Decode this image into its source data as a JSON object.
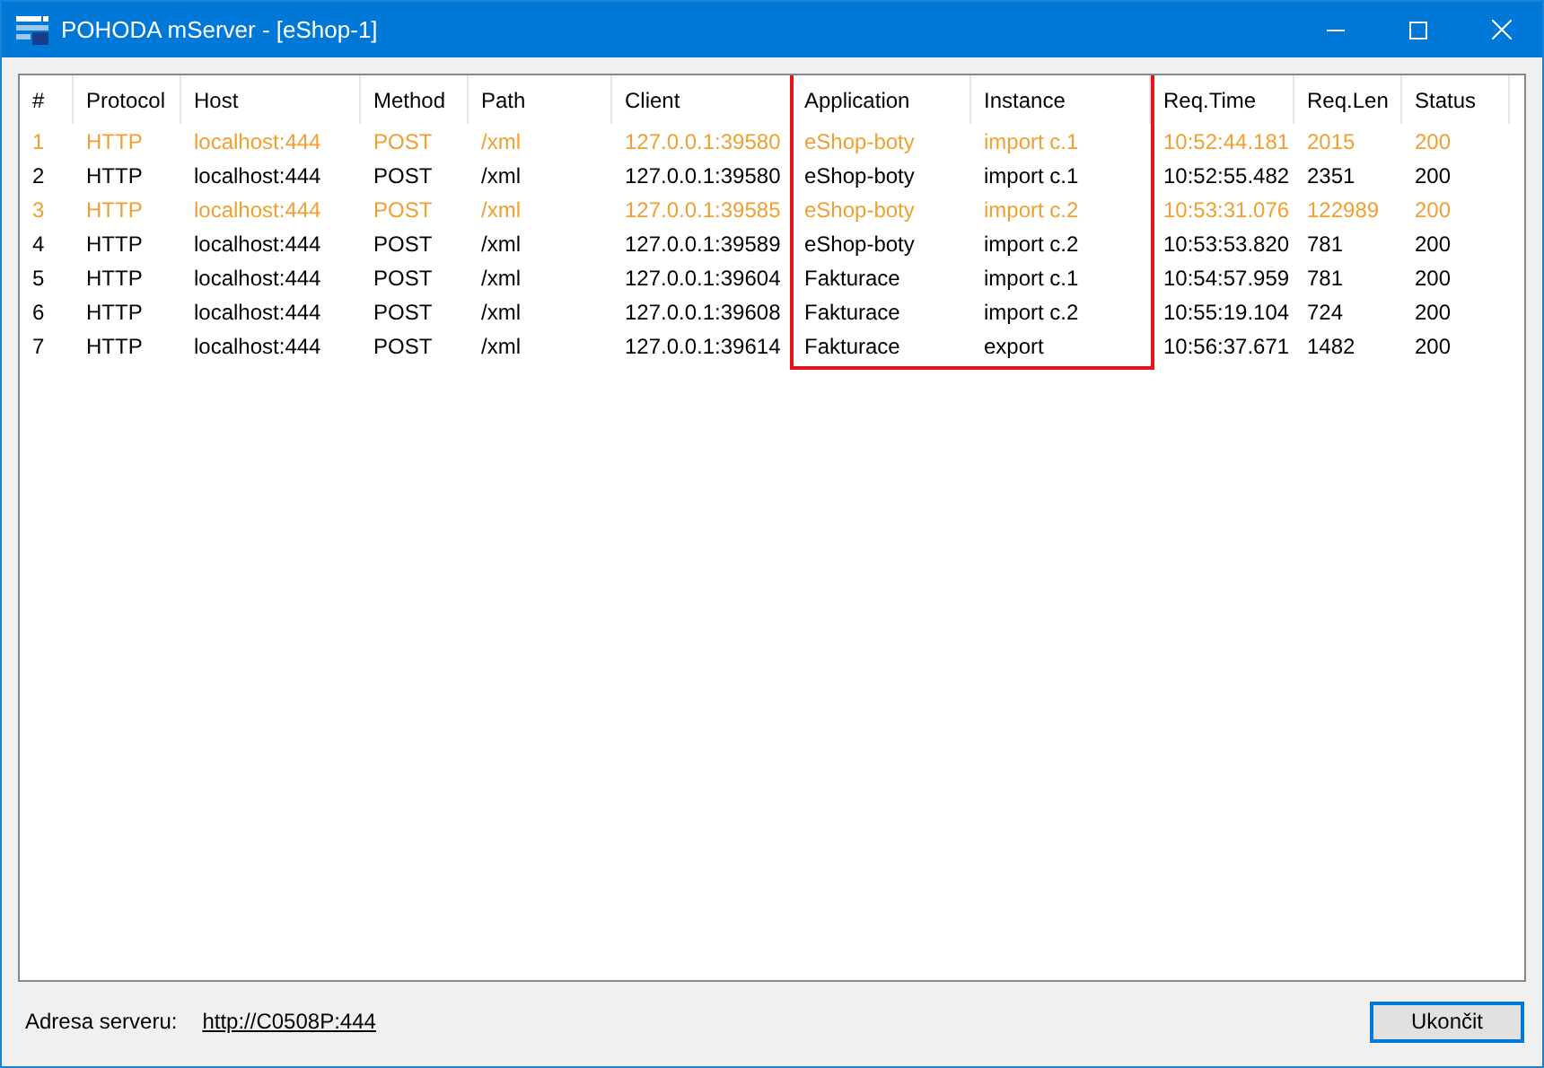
{
  "window": {
    "title": "POHODA mServer - [eShop-1]"
  },
  "table": {
    "columns": [
      {
        "label": "#",
        "outlined": false
      },
      {
        "label": "Protocol",
        "outlined": false
      },
      {
        "label": "Host",
        "outlined": false
      },
      {
        "label": "Method",
        "outlined": false
      },
      {
        "label": "Path",
        "outlined": false
      },
      {
        "label": "Client",
        "outlined": false
      },
      {
        "label": "Application",
        "outlined": true
      },
      {
        "label": "Instance",
        "outlined": true
      },
      {
        "label": "Req.Time",
        "outlined": false
      },
      {
        "label": "Req.Len",
        "outlined": false
      },
      {
        "label": "Status",
        "outlined": false
      }
    ],
    "rows": [
      {
        "color": "#f0a030",
        "cells": [
          "1",
          "HTTP",
          "localhost:444",
          "POST",
          "/xml",
          "127.0.0.1:39580",
          "eShop-boty",
          "import c.1",
          "10:52:44.181",
          "2015",
          "200"
        ]
      },
      {
        "color": "#000000",
        "cells": [
          "2",
          "HTTP",
          "localhost:444",
          "POST",
          "/xml",
          "127.0.0.1:39580",
          "eShop-boty",
          "import c.1",
          "10:52:55.482",
          "2351",
          "200"
        ]
      },
      {
        "color": "#f0a030",
        "cells": [
          "3",
          "HTTP",
          "localhost:444",
          "POST",
          "/xml",
          "127.0.0.1:39585",
          "eShop-boty",
          "import c.2",
          "10:53:31.076",
          "122989",
          "200"
        ]
      },
      {
        "color": "#000000",
        "cells": [
          "4",
          "HTTP",
          "localhost:444",
          "POST",
          "/xml",
          "127.0.0.1:39589",
          "eShop-boty",
          "import c.2",
          "10:53:53.820",
          "781",
          "200"
        ]
      },
      {
        "color": "#000000",
        "cells": [
          "5",
          "HTTP",
          "localhost:444",
          "POST",
          "/xml",
          "127.0.0.1:39604",
          "Fakturace",
          "import c.1",
          "10:54:57.959",
          "781",
          "200"
        ]
      },
      {
        "color": "#000000",
        "cells": [
          "6",
          "HTTP",
          "localhost:444",
          "POST",
          "/xml",
          "127.0.0.1:39608",
          "Fakturace",
          "import c.2",
          "10:55:19.104",
          "724",
          "200"
        ]
      },
      {
        "color": "#000000",
        "cells": [
          "7",
          "HTTP",
          "localhost:444",
          "POST",
          "/xml",
          "127.0.0.1:39614",
          "Fakturace",
          "export",
          "10:56:37.671",
          "1482",
          "200"
        ]
      }
    ]
  },
  "footer": {
    "label": "Adresa serveru:",
    "link": "http://C0508P:444",
    "button": "Ukončit"
  }
}
